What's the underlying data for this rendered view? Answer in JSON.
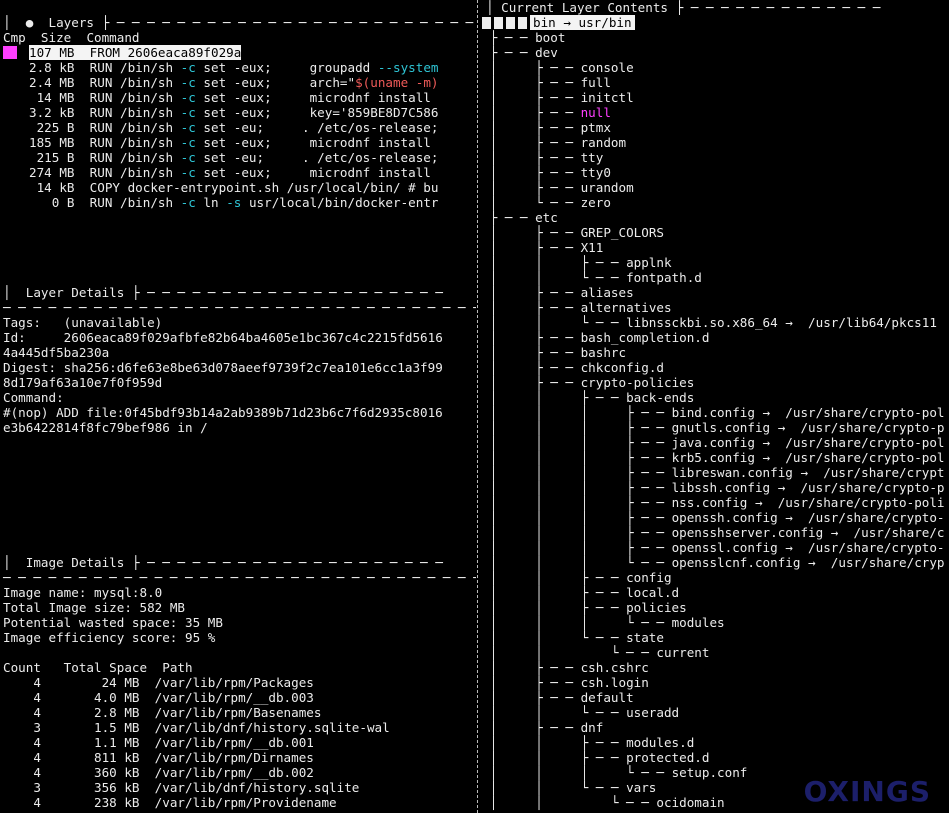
{
  "layers_header": {
    "bullet": "●",
    "title": "Layers"
  },
  "layer_cols": {
    "cmp": "Cmp",
    "size": "Size",
    "command": "Command"
  },
  "layers": [
    {
      "size": "107 MB",
      "parts": [
        {
          "t": "FROM 2606eaca89f029a",
          "c": ""
        }
      ],
      "selected": true
    },
    {
      "size": "2.8 kB",
      "parts": [
        {
          "t": "RUN /bin/sh ",
          "c": ""
        },
        {
          "t": "-c",
          "c": "cyan"
        },
        {
          "t": " set -eux;     groupadd ",
          "c": ""
        },
        {
          "t": "--system",
          "c": "cyan"
        }
      ]
    },
    {
      "size": "2.4 MB",
      "parts": [
        {
          "t": "RUN /bin/sh ",
          "c": ""
        },
        {
          "t": "-c",
          "c": "cyan"
        },
        {
          "t": " set -eux;     arch=\"",
          "c": ""
        },
        {
          "t": "$(uname -m)",
          "c": "red"
        }
      ]
    },
    {
      "size": "14 MB",
      "parts": [
        {
          "t": "RUN /bin/sh ",
          "c": ""
        },
        {
          "t": "-c",
          "c": "cyan"
        },
        {
          "t": " set -eux;     microdnf install",
          "c": ""
        }
      ]
    },
    {
      "size": "3.2 kB",
      "parts": [
        {
          "t": "RUN /bin/sh ",
          "c": ""
        },
        {
          "t": "-c",
          "c": "cyan"
        },
        {
          "t": " set -eux;     key='859BE8D7C586",
          "c": ""
        }
      ]
    },
    {
      "size": "225 B",
      "parts": [
        {
          "t": "RUN /bin/sh ",
          "c": ""
        },
        {
          "t": "-c",
          "c": "cyan"
        },
        {
          "t": " set -eu;     . /etc/os-release;",
          "c": ""
        }
      ]
    },
    {
      "size": "185 MB",
      "parts": [
        {
          "t": "RUN /bin/sh ",
          "c": ""
        },
        {
          "t": "-c",
          "c": "cyan"
        },
        {
          "t": " set -eux;     microdnf install",
          "c": ""
        }
      ]
    },
    {
      "size": "215 B",
      "parts": [
        {
          "t": "RUN /bin/sh ",
          "c": ""
        },
        {
          "t": "-c",
          "c": "cyan"
        },
        {
          "t": " set -eu;     . /etc/os-release;",
          "c": ""
        }
      ]
    },
    {
      "size": "274 MB",
      "parts": [
        {
          "t": "RUN /bin/sh ",
          "c": ""
        },
        {
          "t": "-c",
          "c": "cyan"
        },
        {
          "t": " set -eux;     microdnf install",
          "c": ""
        }
      ]
    },
    {
      "size": "14 kB",
      "parts": [
        {
          "t": "COPY docker-entrypoint.sh /usr/local/bin/ # bu",
          "c": ""
        }
      ]
    },
    {
      "size": "0 B",
      "parts": [
        {
          "t": "RUN /bin/sh ",
          "c": ""
        },
        {
          "t": "-c",
          "c": "cyan"
        },
        {
          "t": " ln ",
          "c": ""
        },
        {
          "t": "-s",
          "c": "cyan"
        },
        {
          "t": " usr/local/bin/docker-entr",
          "c": ""
        }
      ]
    }
  ],
  "layer_details": {
    "title": "Layer Details",
    "tags_label": "Tags:",
    "tags_value": "(unavailable)",
    "id_label": "Id:",
    "id_value_1": "2606eaca89f029afbfe82b64ba4605e1bc367c4c2215fd5616",
    "id_value_2": "4a445df5ba230a",
    "digest_label": "Digest:",
    "digest_value_1": "sha256:d6fe63e8be63d078aeef9739f2c7ea101e6cc1a3f99",
    "digest_value_2": "8d179af63a10e7f0f959d",
    "command_label": "Command:",
    "command_1": "#(nop) ADD file:0f45bdf93b14a2ab9389b71d23b6c7f6d2935c8016",
    "command_2": "e3b6422814f8fc79bef986 in /"
  },
  "image_details": {
    "title": "Image Details",
    "name_label": "Image name:",
    "name_value": "mysql:8.0",
    "size_label": "Total Image size:",
    "size_value": "582 MB",
    "wasted_label": "Potential wasted space:",
    "wasted_value": "35 MB",
    "eff_label": "Image efficiency score:",
    "eff_value": "95 %",
    "columns": {
      "count": "Count",
      "space": "Total Space",
      "path": "Path"
    },
    "rows": [
      {
        "count": "4",
        "space": "24 MB",
        "path": "/var/lib/rpm/Packages"
      },
      {
        "count": "4",
        "space": "4.0 MB",
        "path": "/var/lib/rpm/__db.003"
      },
      {
        "count": "4",
        "space": "2.8 MB",
        "path": "/var/lib/rpm/Basenames"
      },
      {
        "count": "3",
        "space": "1.5 MB",
        "path": "/var/lib/dnf/history.sqlite-wal"
      },
      {
        "count": "4",
        "space": "1.1 MB",
        "path": "/var/lib/rpm/__db.001"
      },
      {
        "count": "4",
        "space": "811 kB",
        "path": "/var/lib/rpm/Dirnames"
      },
      {
        "count": "4",
        "space": "360 kB",
        "path": "/var/lib/rpm/__db.002"
      },
      {
        "count": "3",
        "space": "356 kB",
        "path": "/var/lib/dnf/history.sqlite"
      },
      {
        "count": "4",
        "space": "238 kB",
        "path": "/var/lib/rpm/Providename"
      }
    ]
  },
  "contents_header": {
    "title": "Current Layer Contents"
  },
  "tree": [
    {
      "p": "",
      "n": "bin → usr/bin",
      "sel": true
    },
    {
      "p": "├── ",
      "n": "boot"
    },
    {
      "p": "├── ",
      "n": "dev"
    },
    {
      "p": "│   ├── ",
      "n": "console"
    },
    {
      "p": "│   ├── ",
      "n": "full"
    },
    {
      "p": "│   ├── ",
      "n": "initctl"
    },
    {
      "p": "│   ├── ",
      "n": "null",
      "c": "mag"
    },
    {
      "p": "│   ├── ",
      "n": "ptmx"
    },
    {
      "p": "│   ├── ",
      "n": "random"
    },
    {
      "p": "│   ├── ",
      "n": "tty"
    },
    {
      "p": "│   ├── ",
      "n": "tty0"
    },
    {
      "p": "│   ├── ",
      "n": "urandom"
    },
    {
      "p": "│   └── ",
      "n": "zero"
    },
    {
      "p": "├── ",
      "n": "etc"
    },
    {
      "p": "│   ├── ",
      "n": "GREP_COLORS"
    },
    {
      "p": "│   ├── ",
      "n": "X11"
    },
    {
      "p": "│   │   ├── ",
      "n": "applnk"
    },
    {
      "p": "│   │   └── ",
      "n": "fontpath.d"
    },
    {
      "p": "│   ├── ",
      "n": "aliases"
    },
    {
      "p": "│   ├── ",
      "n": "alternatives"
    },
    {
      "p": "│   │   └── ",
      "n": "libnssckbi.so.x86_64 →  /usr/lib64/pkcs11"
    },
    {
      "p": "│   ├── ",
      "n": "bash_completion.d"
    },
    {
      "p": "│   ├── ",
      "n": "bashrc"
    },
    {
      "p": "│   ├── ",
      "n": "chkconfig.d"
    },
    {
      "p": "│   ├── ",
      "n": "crypto-policies"
    },
    {
      "p": "│   │   ├── ",
      "n": "back-ends"
    },
    {
      "p": "│   │   │   ├── ",
      "n": "bind.config →  /usr/share/crypto-pol"
    },
    {
      "p": "│   │   │   ├── ",
      "n": "gnutls.config →  /usr/share/crypto-p"
    },
    {
      "p": "│   │   │   ├── ",
      "n": "java.config →  /usr/share/crypto-pol"
    },
    {
      "p": "│   │   │   ├── ",
      "n": "krb5.config →  /usr/share/crypto-pol"
    },
    {
      "p": "│   │   │   ├── ",
      "n": "libreswan.config →  /usr/share/crypt"
    },
    {
      "p": "│   │   │   ├── ",
      "n": "libssh.config →  /usr/share/crypto-p"
    },
    {
      "p": "│   │   │   ├── ",
      "n": "nss.config →  /usr/share/crypto-poli"
    },
    {
      "p": "│   │   │   ├── ",
      "n": "openssh.config →  /usr/share/crypto-"
    },
    {
      "p": "│   │   │   ├── ",
      "n": "opensshserver.config →  /usr/share/c"
    },
    {
      "p": "│   │   │   ├── ",
      "n": "openssl.config →  /usr/share/crypto-"
    },
    {
      "p": "│   │   │   └── ",
      "n": "opensslcnf.config →  /usr/share/cryp"
    },
    {
      "p": "│   │   ├── ",
      "n": "config"
    },
    {
      "p": "│   │   ├── ",
      "n": "local.d"
    },
    {
      "p": "│   │   ├── ",
      "n": "policies"
    },
    {
      "p": "│   │   │   └── ",
      "n": "modules"
    },
    {
      "p": "│   │   └── ",
      "n": "state"
    },
    {
      "p": "│   │       └── ",
      "n": "current"
    },
    {
      "p": "│   ├── ",
      "n": "csh.cshrc"
    },
    {
      "p": "│   ├── ",
      "n": "csh.login"
    },
    {
      "p": "│   ├── ",
      "n": "default"
    },
    {
      "p": "│   │   └── ",
      "n": "useradd"
    },
    {
      "p": "│   ├── ",
      "n": "dnf"
    },
    {
      "p": "│   │   ├── ",
      "n": "modules.d"
    },
    {
      "p": "│   │   ├── ",
      "n": "protected.d"
    },
    {
      "p": "│   │   │   └── ",
      "n": "setup.conf"
    },
    {
      "p": "│   │   └── ",
      "n": "vars"
    },
    {
      "p": "│   │       └── ",
      "n": "ocidomain"
    }
  ],
  "watermark": "OXINGS"
}
